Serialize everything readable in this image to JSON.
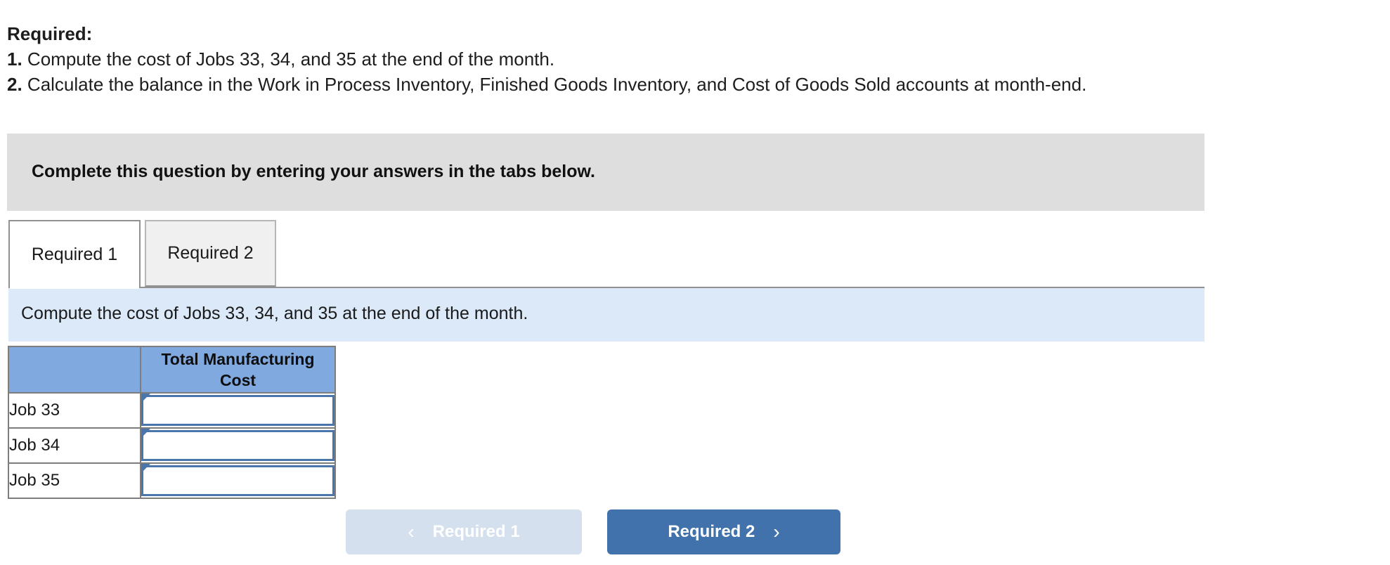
{
  "required": {
    "heading": "Required:",
    "items": [
      {
        "num": "1.",
        "text": "Compute the cost of Jobs 33, 34, and 35 at the end of the month."
      },
      {
        "num": "2.",
        "text": "Calculate the balance in the Work in Process Inventory, Finished Goods Inventory, and Cost of Goods Sold accounts at month-end."
      }
    ]
  },
  "instruction_banner": {
    "text": "Complete this question by entering your answers in the tabs below."
  },
  "tabs": [
    {
      "label": "Required 1",
      "active": true
    },
    {
      "label": "Required 2",
      "active": false
    }
  ],
  "sub_instruction": {
    "text": "Compute the cost of Jobs 33, 34, and 35 at the end of the month."
  },
  "answer_table": {
    "headers": [
      "",
      "Total Manufacturing Cost"
    ],
    "rows": [
      {
        "label": "Job 33",
        "value": ""
      },
      {
        "label": "Job 34",
        "value": ""
      },
      {
        "label": "Job 35",
        "value": ""
      }
    ]
  },
  "footer_nav": {
    "prev": {
      "label": "Required 1",
      "icon": "chevron-left-icon",
      "glyph": "‹"
    },
    "next": {
      "label": "Required 2",
      "icon": "chevron-right-icon",
      "glyph": "›"
    }
  },
  "colors": {
    "banner_gray": "#dedede",
    "sub_instruction_blue": "#dbe9f8",
    "table_header_blue": "#80a9e0",
    "input_border_blue": "#4a76ab",
    "button_primary": "#4272ab",
    "button_disabled": "#d4e0ed"
  }
}
